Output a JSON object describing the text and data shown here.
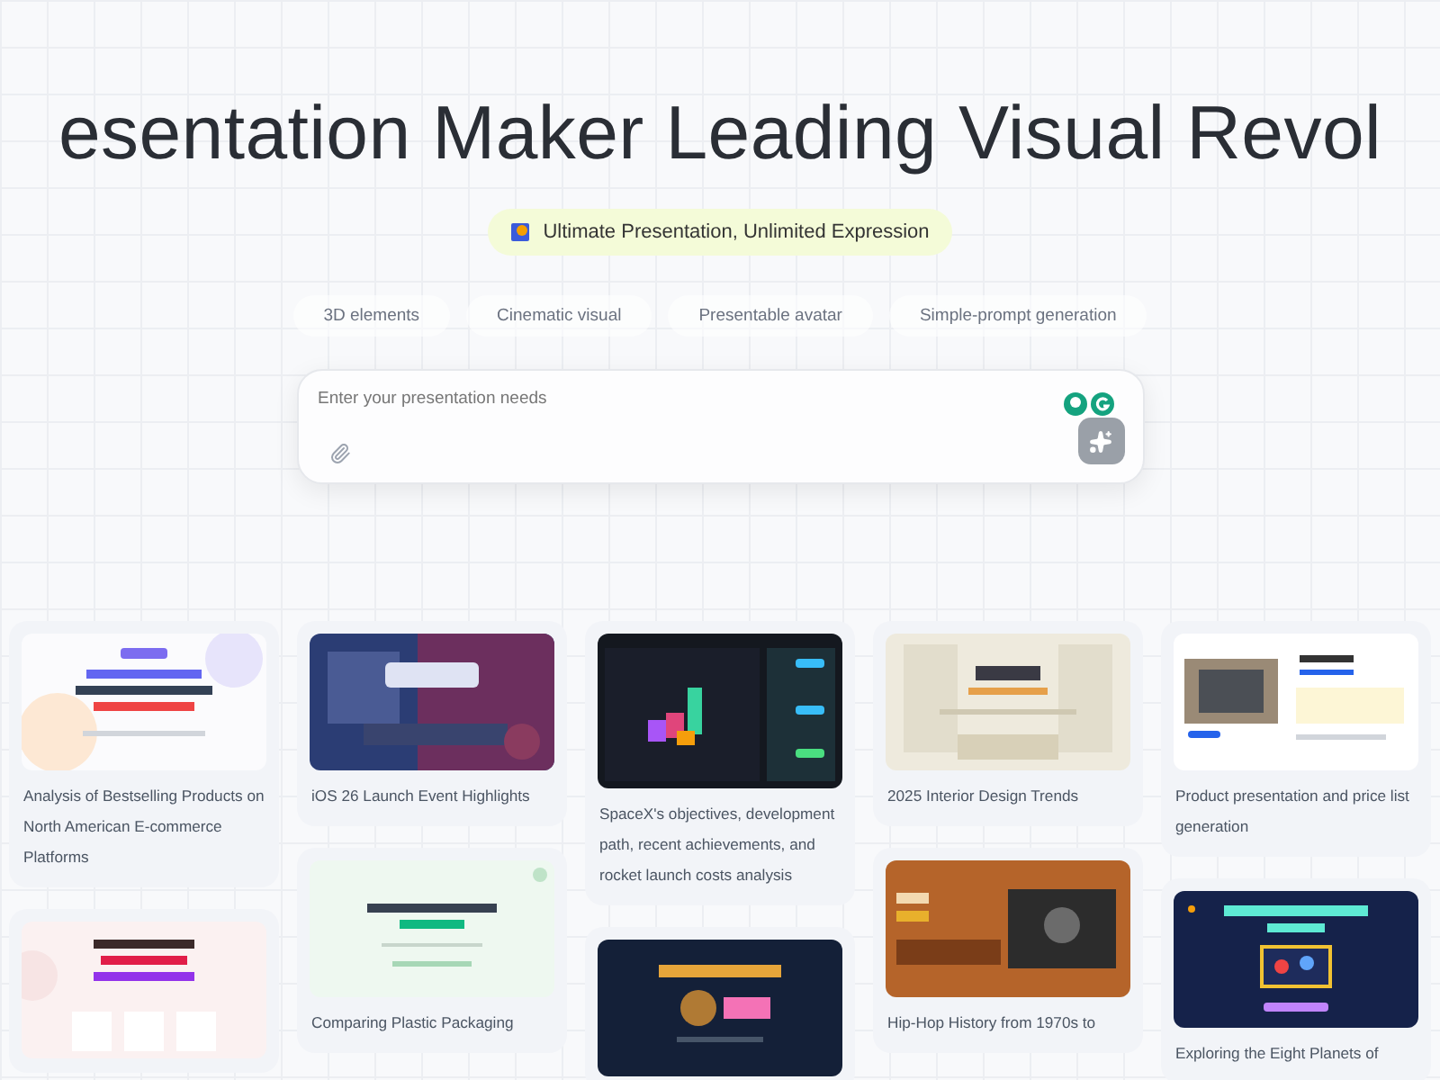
{
  "headline": "esentation Maker Leading Visual Revol",
  "badge": {
    "text": "Ultimate Presentation, Unlimited Expression"
  },
  "features": [
    {
      "label": "3D elements"
    },
    {
      "label": "Cinematic visual"
    },
    {
      "label": "Presentable avatar"
    },
    {
      "label": "Simple-prompt generation"
    }
  ],
  "prompt": {
    "placeholder": "Enter your presentation needs"
  },
  "gallery": {
    "columns": [
      {
        "cards": [
          {
            "kind": "pastel",
            "title": "Analysis of Bestselling Products on North American E-commerce Platforms"
          },
          {
            "kind": "blush"
          }
        ]
      },
      {
        "cards": [
          {
            "kind": "stage",
            "title": "iOS 26 Launch Event Highlights"
          },
          {
            "kind": "mint",
            "title": "Comparing Plastic Packaging"
          }
        ]
      },
      {
        "cards": [
          {
            "kind": "dashboard",
            "title": "SpaceX's objectives, development path, recent achievements, and rocket launch costs analysis"
          },
          {
            "kind": "navy"
          }
        ]
      },
      {
        "cards": [
          {
            "kind": "room",
            "title": "2025 Interior Design Trends"
          },
          {
            "kind": "rust",
            "title": "Hip-Hop History from 1970s to"
          }
        ]
      },
      {
        "cards": [
          {
            "kind": "product",
            "title": "Product presentation and price list generation"
          },
          {
            "kind": "space",
            "title": "Exploring the Eight Planets of"
          }
        ]
      }
    ]
  }
}
